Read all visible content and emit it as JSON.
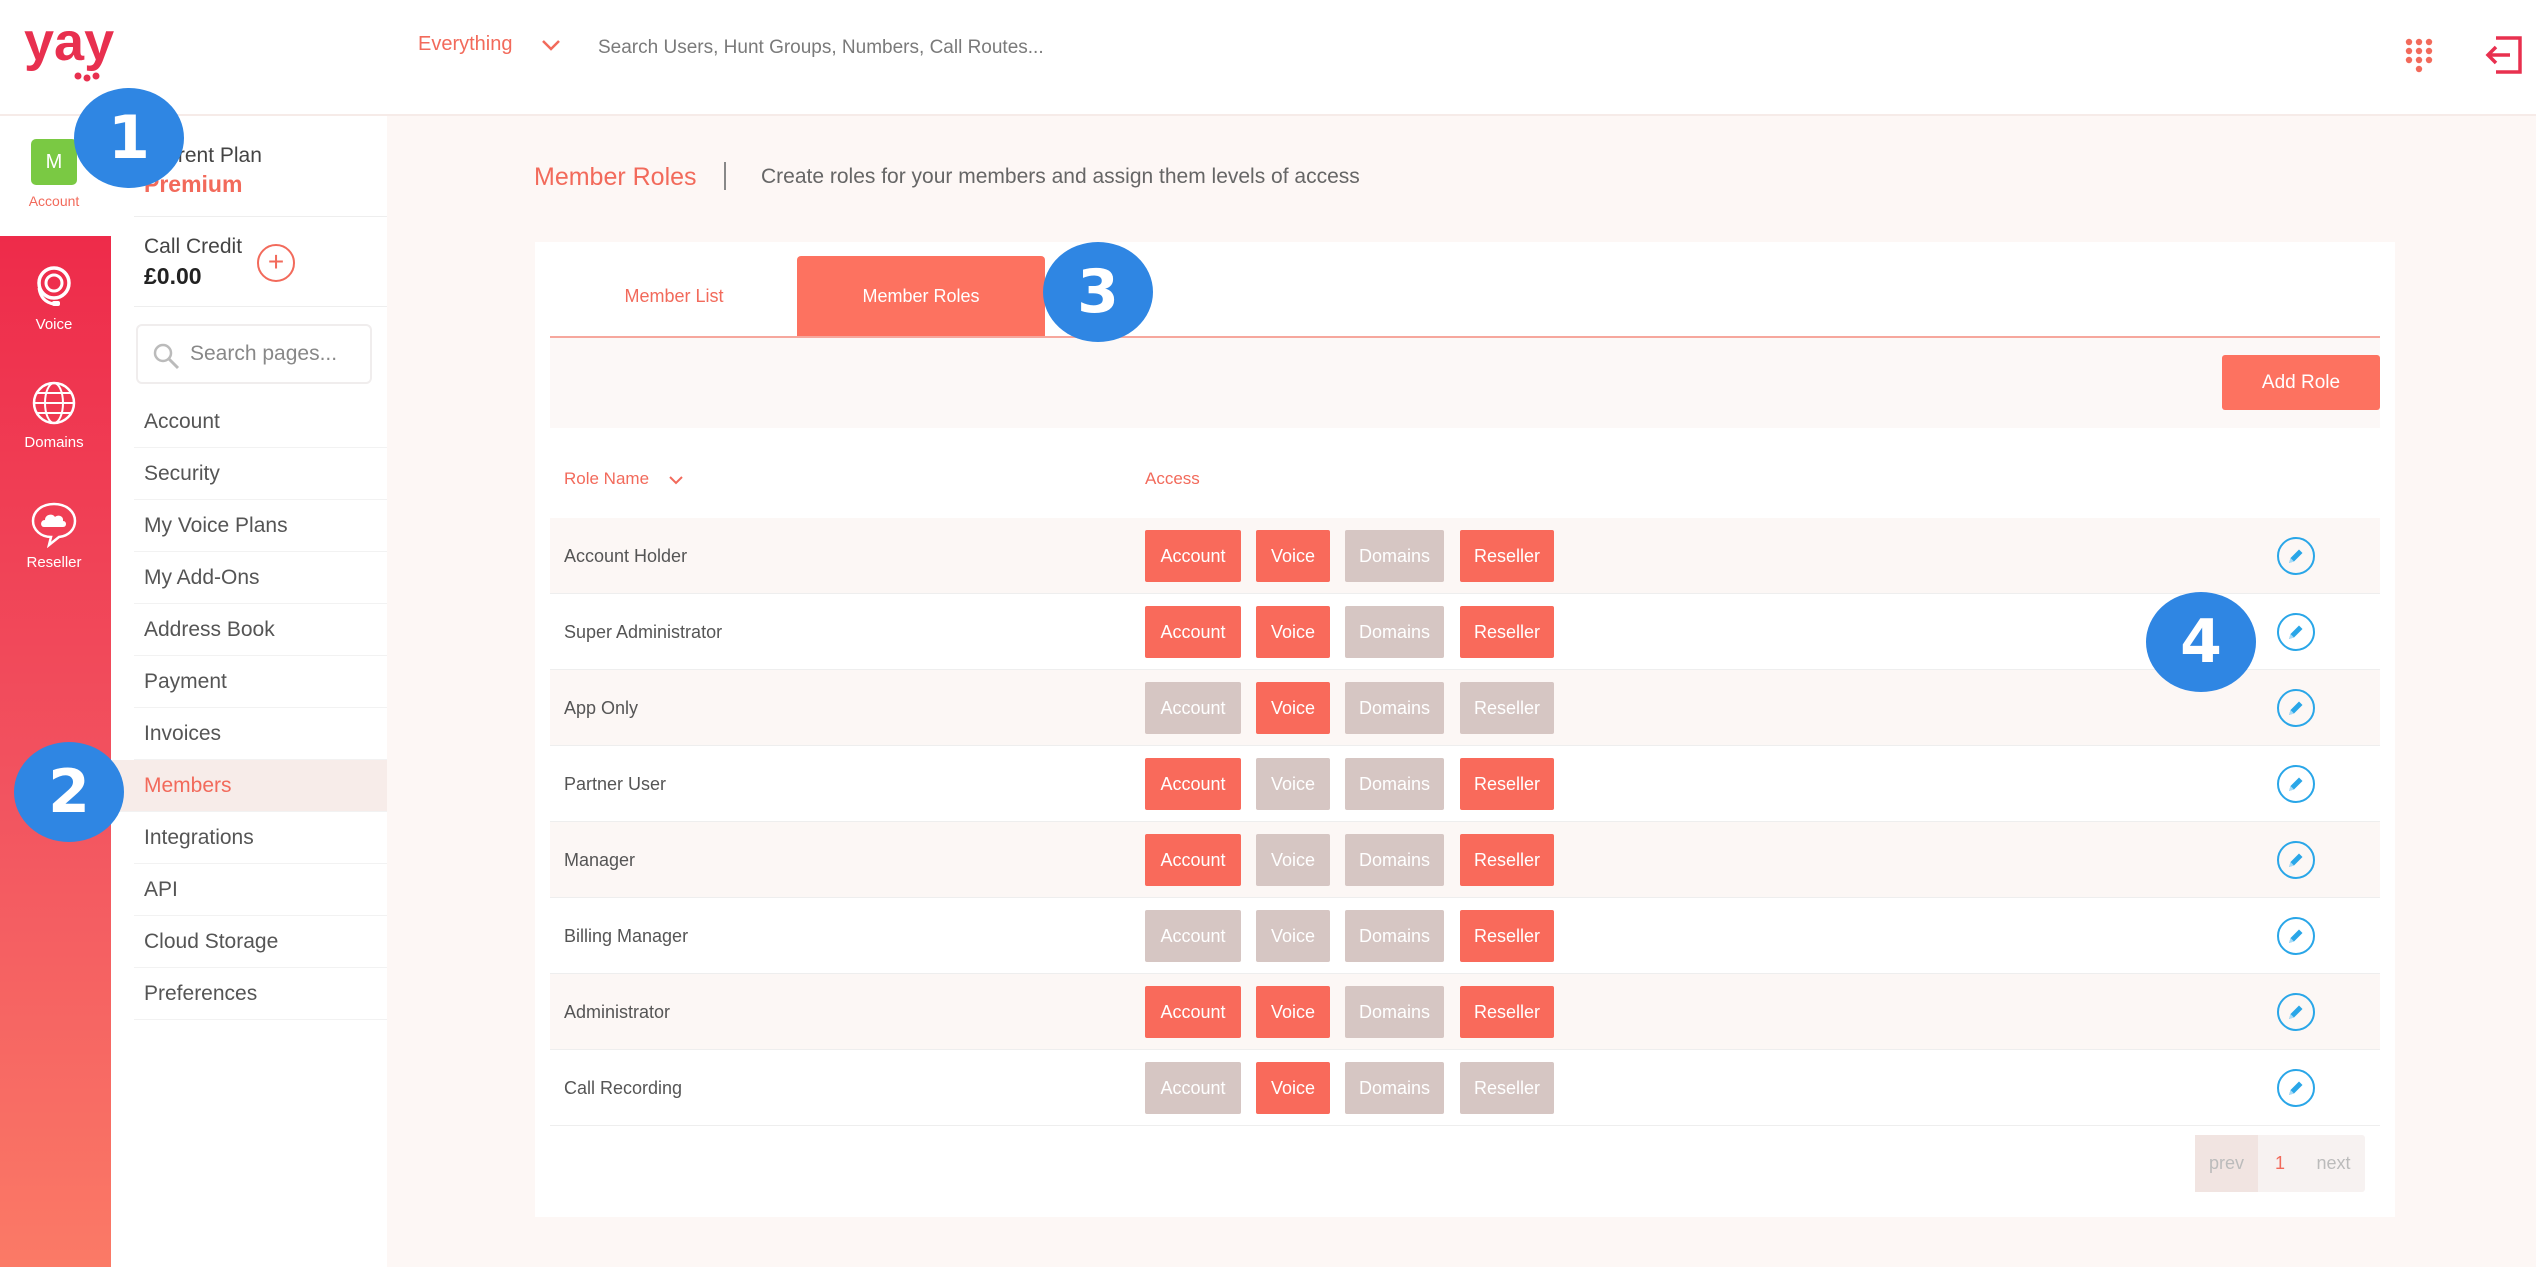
{
  "brand": {
    "name": "yay",
    "color": "#e8304f"
  },
  "topbar": {
    "scope_label": "Everything",
    "search_placeholder": "Search Users, Hunt Groups, Numbers, Call Routes..."
  },
  "rail": {
    "account_initial": "M",
    "account_label": "Account",
    "items": [
      {
        "label": "Voice",
        "icon": "headset-icon"
      },
      {
        "label": "Domains",
        "icon": "globe-icon"
      },
      {
        "label": "Reseller",
        "icon": "cloud-chat-icon"
      }
    ]
  },
  "subnav": {
    "plan_label": "Current Plan",
    "plan_value": "Premium",
    "credit_label": "Call Credit",
    "credit_value": "£0.00",
    "search_placeholder": "Search pages...",
    "items": [
      "Account",
      "Security",
      "My Voice Plans",
      "My Add-Ons",
      "Address Book",
      "Payment",
      "Invoices",
      "Members",
      "Integrations",
      "API",
      "Cloud Storage",
      "Preferences"
    ],
    "active": "Members"
  },
  "page": {
    "title": "Member Roles",
    "subtitle": "Create roles for your members and assign them levels of access"
  },
  "tabs": [
    "Member List",
    "Member Roles"
  ],
  "add_role_label": "Add Role",
  "table": {
    "headers": [
      "Role Name",
      "Access"
    ],
    "access_labels": [
      "Account",
      "Voice",
      "Domains",
      "Reseller"
    ],
    "rows": [
      {
        "name": "Account Holder",
        "access": [
          true,
          true,
          false,
          true
        ]
      },
      {
        "name": "Super Administrator",
        "access": [
          true,
          true,
          false,
          true
        ]
      },
      {
        "name": "App Only",
        "access": [
          false,
          true,
          false,
          false
        ]
      },
      {
        "name": "Partner User",
        "access": [
          true,
          false,
          false,
          true
        ]
      },
      {
        "name": "Manager",
        "access": [
          true,
          false,
          false,
          true
        ]
      },
      {
        "name": "Billing Manager",
        "access": [
          false,
          false,
          false,
          true
        ]
      },
      {
        "name": "Administrator",
        "access": [
          true,
          true,
          false,
          true
        ]
      },
      {
        "name": "Call Recording",
        "access": [
          false,
          true,
          false,
          false
        ]
      }
    ]
  },
  "pagination": {
    "prev": "prev",
    "current": "1",
    "next": "next"
  },
  "callouts": [
    "1",
    "2",
    "3",
    "4"
  ],
  "colors": {
    "accent": "#f26a5b",
    "chip_on": "#f96a5b",
    "chip_off": "#d6c6c3",
    "edit": "#29a6e8",
    "callout": "#2f86e3"
  }
}
